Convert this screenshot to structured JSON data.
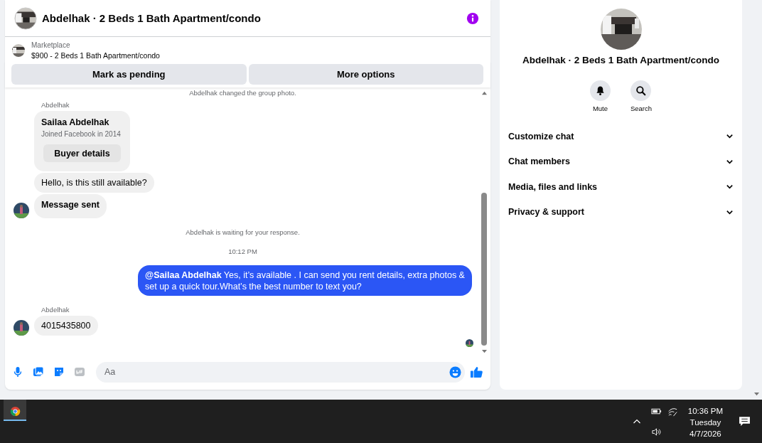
{
  "chat": {
    "title": "Abdelhak · 2 Beds 1 Bath Apartment/condo",
    "listing": {
      "source": "Marketplace",
      "title": "$900 - 2 Beds 1 Bath Apartment/condo"
    },
    "actions": [
      "Mark as pending",
      "More options"
    ],
    "messages": [
      {
        "kind": "system",
        "text": "Abdelhak changed the group photo."
      },
      {
        "kind": "sender",
        "text": "Abdelhak"
      },
      {
        "kind": "buyer_card",
        "name": "Sailaa Abdelhak",
        "subtitle": "Joined Facebook in 2014",
        "button": "Buyer details"
      },
      {
        "kind": "incoming",
        "text": "Hello, is this still available?",
        "avatar": false,
        "bold": false
      },
      {
        "kind": "incoming",
        "text": "Message sent",
        "avatar": true,
        "bold": true
      },
      {
        "kind": "system",
        "text": "Abdelhak is waiting for your response."
      },
      {
        "kind": "time",
        "text": "10:12 PM"
      },
      {
        "kind": "outgoing",
        "text": "**@Sailaa Abdelhak** Yes, it’s available .  I can send you rent details, extra photos & set up a quick tour.What’s the best number to text you?"
      },
      {
        "kind": "sender",
        "text": "Abdelhak"
      },
      {
        "kind": "incoming",
        "text": "4015435800",
        "avatar": true,
        "bold": false
      },
      {
        "kind": "seen"
      }
    ],
    "composer": {
      "placeholder": "Aa"
    }
  },
  "details": {
    "title": "Abdelhak · 2 Beds 1 Bath Apartment/condo",
    "actions": [
      {
        "kind": "mute",
        "label": "Mute"
      },
      {
        "kind": "search",
        "label": "Search"
      }
    ],
    "sections": [
      {
        "label": "Customize chat",
        "expanded": false
      },
      {
        "label": "Chat members",
        "expanded": false
      },
      {
        "label": "Media, files and links",
        "expanded": false
      },
      {
        "label": "Privacy & support",
        "expanded": false
      }
    ]
  },
  "taskbar": {
    "time": "10:36 PM",
    "day": "Tuesday",
    "date": "4/7/2026"
  }
}
